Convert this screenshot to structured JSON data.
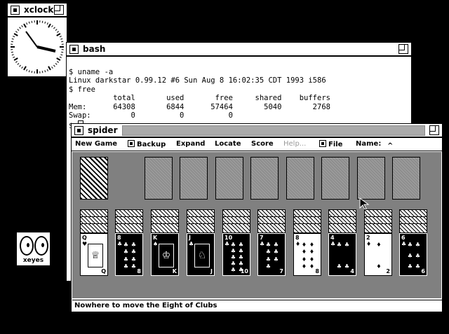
{
  "xclock": {
    "title": "xclock"
  },
  "xeyes": {
    "label": "xeyes"
  },
  "bash": {
    "title": "bash",
    "lines": [
      "$ uname -a",
      "Linux darkstar 0.99.12 #6 Sun Aug 8 16:02:35 CDT 1993 i586",
      "$ free",
      "          total       used       free     shared    buffers",
      "Mem:      64308       6844      57464       5040       2768",
      "Swap:         0          0          0",
      "$ "
    ]
  },
  "spider": {
    "title": "spider",
    "menu": {
      "new_game": "New Game",
      "backup": "Backup",
      "expand": "Expand",
      "locate": "Locate",
      "score": "Score",
      "help": "Help...",
      "file": "File",
      "name": "Name:",
      "name_caret": "^"
    },
    "status": "Nowhere to move the Eight of Clubs",
    "columns": [
      {
        "down": 3,
        "rank": "Q",
        "suit": "♥",
        "dark": false
      },
      {
        "down": 3,
        "rank": "8",
        "suit": "♣",
        "dark": true
      },
      {
        "down": 3,
        "rank": "K",
        "suit": "♠",
        "dark": true
      },
      {
        "down": 3,
        "rank": "J",
        "suit": "♣",
        "dark": true
      },
      {
        "down": 3,
        "rank": "10",
        "suit": "♣",
        "dark": true
      },
      {
        "down": 3,
        "rank": "7",
        "suit": "♣",
        "dark": true
      },
      {
        "down": 3,
        "rank": "8",
        "suit": "♦",
        "dark": false
      },
      {
        "down": 3,
        "rank": "4",
        "suit": "♣",
        "dark": true
      },
      {
        "down": 3,
        "rank": "2",
        "suit": "♦",
        "dark": false
      },
      {
        "down": 3,
        "rank": "6",
        "suit": "♣",
        "dark": true
      }
    ]
  }
}
